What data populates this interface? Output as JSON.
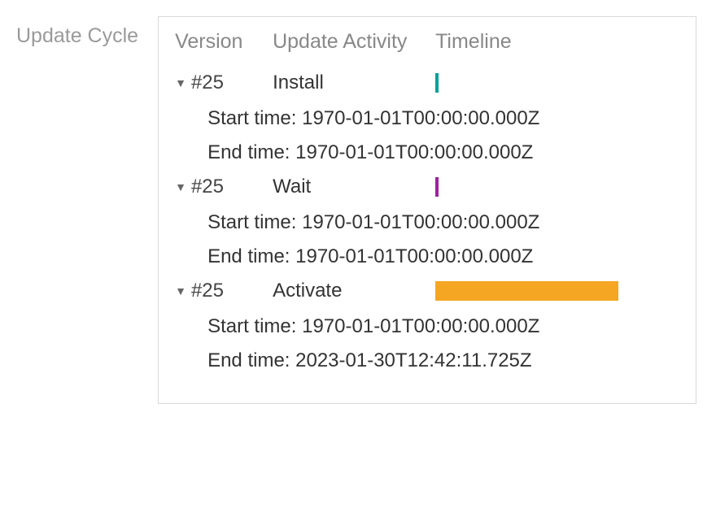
{
  "title": "Update Cycle",
  "headers": {
    "version": "Version",
    "activity": "Update Activity",
    "timeline": "Timeline"
  },
  "labels": {
    "start": "Start time: ",
    "end": "End time: "
  },
  "rows": [
    {
      "version": "#25",
      "activity": "Install",
      "color": "#00a19a",
      "barWidth": "4px",
      "start": "1970-01-01T00:00:00.000Z",
      "end": "1970-01-01T00:00:00.000Z"
    },
    {
      "version": "#25",
      "activity": "Wait",
      "color": "#a020a0",
      "barWidth": "4px",
      "start": "1970-01-01T00:00:00.000Z",
      "end": "1970-01-01T00:00:00.000Z"
    },
    {
      "version": "#25",
      "activity": "Activate",
      "color": "#f5a623",
      "barWidth": "225px",
      "start": "1970-01-01T00:00:00.000Z",
      "end": "2023-01-30T12:42:11.725Z"
    }
  ]
}
